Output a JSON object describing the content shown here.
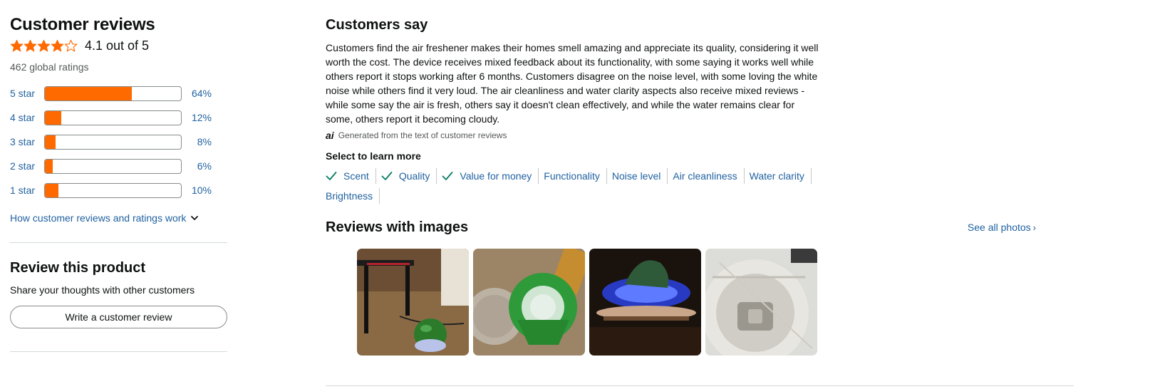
{
  "colors": {
    "star": "#ff6a00",
    "bar": "#ff6a00",
    "link": "#2162a1",
    "check": "#067d62"
  },
  "reviews": {
    "title": "Customer reviews",
    "rating_value": 4.1,
    "rating_text": "4.1 out of 5",
    "global_ratings": "462 global ratings",
    "histogram": [
      {
        "label": "5 star",
        "percent": 64,
        "percent_text": "64%"
      },
      {
        "label": "4 star",
        "percent": 12,
        "percent_text": "12%"
      },
      {
        "label": "3 star",
        "percent": 8,
        "percent_text": "8%"
      },
      {
        "label": "2 star",
        "percent": 6,
        "percent_text": "6%"
      },
      {
        "label": "1 star",
        "percent": 10,
        "percent_text": "10%"
      }
    ],
    "how_link": "How customer reviews and ratings work"
  },
  "review_product": {
    "title": "Review this product",
    "subtitle": "Share your thoughts with other customers",
    "button_label": "Write a customer review"
  },
  "customers_say": {
    "title": "Customers say",
    "summary": "Customers find the air freshener makes their homes smell amazing and appreciate its quality, considering it well worth the cost. The device receives mixed feedback about its functionality, with some saying it works well while others report it stops working after 6 months. Customers disagree on the noise level, with some loving the white noise while others find it very loud. The air cleanliness and water clarity aspects also receive mixed reviews - while some say the air is fresh, others say it doesn't clean effectively, and while the water remains clear for some, others report it becoming cloudy.",
    "ai_icon": "ai",
    "ai_note": "Generated from the text of customer reviews",
    "select_label": "Select to learn more",
    "aspects": [
      {
        "label": "Scent",
        "positive": true
      },
      {
        "label": "Quality",
        "positive": true
      },
      {
        "label": "Value for money",
        "positive": true
      },
      {
        "label": "Functionality",
        "positive": false
      },
      {
        "label": "Noise level",
        "positive": false
      },
      {
        "label": "Air cleanliness",
        "positive": false
      },
      {
        "label": "Water clarity",
        "positive": false
      },
      {
        "label": "Brightness",
        "positive": false
      }
    ]
  },
  "reviews_with_images": {
    "title": "Reviews with images",
    "see_all": "See all photos",
    "see_all_icon": "chevron-right-icon",
    "photos": [
      "photo-1",
      "photo-2",
      "photo-3",
      "photo-4"
    ]
  }
}
